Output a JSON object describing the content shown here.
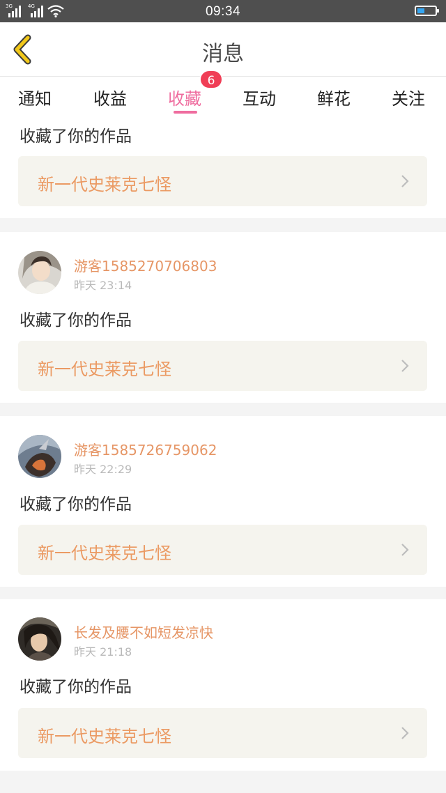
{
  "status_bar": {
    "signal1_tag": "3G",
    "signal2_tag": "4G",
    "time": "09:34",
    "battery_level": 0.4,
    "battery_color": "#35a6f1"
  },
  "header": {
    "title": "消息",
    "back_icon": "chevron-left-icon",
    "back_color": "#f2c81a"
  },
  "tabs": [
    {
      "label": "通知"
    },
    {
      "label": "收益"
    },
    {
      "label": "收藏",
      "active": true,
      "badge": "6"
    },
    {
      "label": "互动"
    },
    {
      "label": "鲜花"
    },
    {
      "label": "关注"
    }
  ],
  "colors": {
    "accent": "#ef6d9f",
    "badge": "#f03e56",
    "username": "#e69666",
    "work_title": "#eb9a63"
  },
  "notifications": [
    {
      "action": "收藏了你的作品",
      "work_title": "新一代史莱克七怪"
    },
    {
      "username": "游客1585270706803",
      "time": "昨天 23:14",
      "action": "收藏了你的作品",
      "work_title": "新一代史莱克七怪"
    },
    {
      "username": "游客1585726759062",
      "time": "昨天 22:29",
      "action": "收藏了你的作品",
      "work_title": "新一代史莱克七怪"
    },
    {
      "username": "长发及腰不如短发凉快",
      "time": "昨天 21:18",
      "action": "收藏了你的作品",
      "work_title": "新一代史莱克七怪"
    }
  ]
}
